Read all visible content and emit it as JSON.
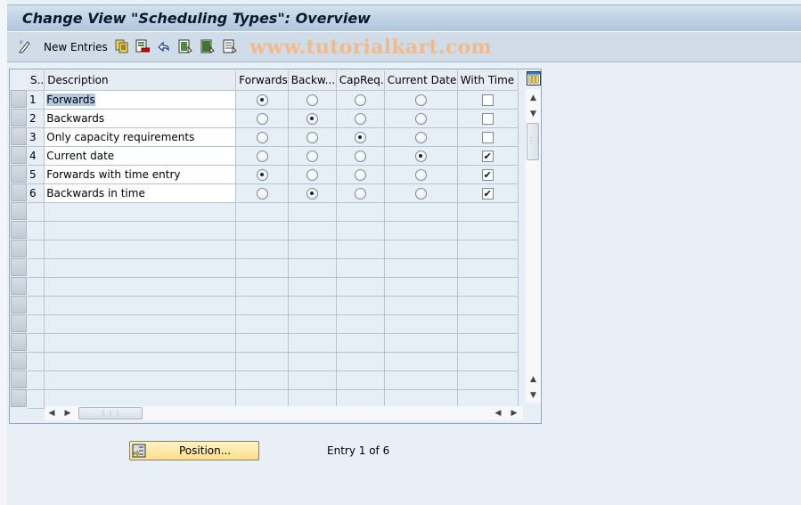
{
  "window": {
    "title": "Change View \"Scheduling Types\": Overview"
  },
  "toolbar": {
    "items": [
      {
        "icon": "edit-pencil-icon",
        "label": ""
      },
      {
        "icon": "new-entries",
        "label": "New Entries"
      },
      {
        "icon": "copy-as-icon",
        "label": ""
      },
      {
        "icon": "delete-icon",
        "label": ""
      },
      {
        "icon": "undo-change-icon",
        "label": ""
      },
      {
        "icon": "select-all-icon",
        "label": ""
      },
      {
        "icon": "select-block-icon",
        "label": ""
      },
      {
        "icon": "deselect-all-icon",
        "label": ""
      }
    ],
    "new_entries_label": "New Entries",
    "watermark": "www.tutorialkart.com"
  },
  "table": {
    "columns": [
      "S..",
      "Description",
      "Forwards",
      "Backw...",
      "CapReq.",
      "Current Date",
      "With Time"
    ],
    "rows": [
      {
        "seq": "1",
        "description": "Forwards",
        "forwards": true,
        "backwards": false,
        "capreq": false,
        "current_date": false,
        "with_time": false
      },
      {
        "seq": "2",
        "description": "Backwards",
        "forwards": false,
        "backwards": true,
        "capreq": false,
        "current_date": false,
        "with_time": false
      },
      {
        "seq": "3",
        "description": "Only capacity requirements",
        "forwards": false,
        "backwards": false,
        "capreq": true,
        "current_date": false,
        "with_time": false
      },
      {
        "seq": "4",
        "description": "Current date",
        "forwards": false,
        "backwards": false,
        "capreq": false,
        "current_date": true,
        "with_time": true
      },
      {
        "seq": "5",
        "description": "Forwards with time entry",
        "forwards": true,
        "backwards": false,
        "capreq": false,
        "current_date": false,
        "with_time": true
      },
      {
        "seq": "6",
        "description": "Backwards in time",
        "forwards": false,
        "backwards": true,
        "capreq": false,
        "current_date": false,
        "with_time": true
      }
    ],
    "empty_rows": 11
  },
  "footer": {
    "position_button_label": "Position...",
    "entry_info": "Entry 1 of 6"
  }
}
